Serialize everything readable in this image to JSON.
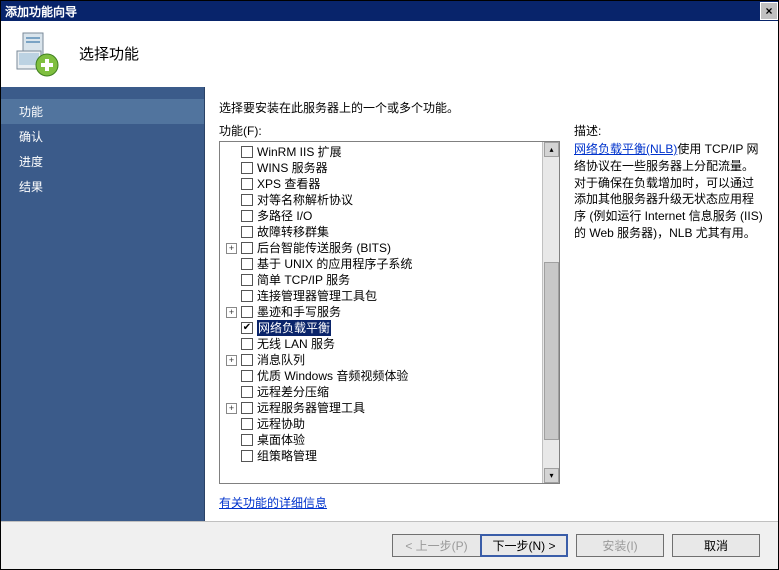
{
  "window": {
    "title": "添加功能向导",
    "close_icon": "×"
  },
  "header": {
    "title": "选择功能"
  },
  "sidebar": {
    "steps": [
      {
        "label": "功能",
        "active": true
      },
      {
        "label": "确认",
        "active": false
      },
      {
        "label": "进度",
        "active": false
      },
      {
        "label": "结果",
        "active": false
      }
    ]
  },
  "main": {
    "instruction": "选择要安装在此服务器上的一个或多个功能。",
    "features_label": "功能(F):",
    "desc_label": "描述:",
    "desc_link_text": "网络负载平衡(NLB)",
    "desc_rest": "使用 TCP/IP 网络协议在一些服务器上分配流量。对于确保在负载增加时，可以通过添加其他服务器升级无状态应用程序 (例如运行 Internet 信息服务 (IIS)的 Web 服务器)，NLB 尤其有用。",
    "more_link": "有关功能的详细信息",
    "tree": [
      {
        "label": "WinRM IIS 扩展",
        "expandable": false,
        "checked": false
      },
      {
        "label": "WINS 服务器",
        "expandable": false,
        "checked": false
      },
      {
        "label": "XPS 查看器",
        "expandable": false,
        "checked": false
      },
      {
        "label": "对等名称解析协议",
        "expandable": false,
        "checked": false
      },
      {
        "label": "多路径 I/O",
        "expandable": false,
        "checked": false
      },
      {
        "label": "故障转移群集",
        "expandable": false,
        "checked": false
      },
      {
        "label": "后台智能传送服务 (BITS)",
        "expandable": true,
        "checked": false
      },
      {
        "label": "基于 UNIX 的应用程序子系统",
        "expandable": false,
        "checked": false
      },
      {
        "label": "简单 TCP/IP 服务",
        "expandable": false,
        "checked": false
      },
      {
        "label": "连接管理器管理工具包",
        "expandable": false,
        "checked": false
      },
      {
        "label": "墨迹和手写服务",
        "expandable": true,
        "checked": false
      },
      {
        "label": "网络负载平衡",
        "expandable": false,
        "checked": true,
        "selected": true
      },
      {
        "label": "无线 LAN 服务",
        "expandable": false,
        "checked": false
      },
      {
        "label": "消息队列",
        "expandable": true,
        "checked": false
      },
      {
        "label": "优质 Windows 音频视频体验",
        "expandable": false,
        "checked": false
      },
      {
        "label": "远程差分压缩",
        "expandable": false,
        "checked": false
      },
      {
        "label": "远程服务器管理工具",
        "expandable": true,
        "checked": false
      },
      {
        "label": "远程协助",
        "expandable": false,
        "checked": false
      },
      {
        "label": "桌面体验",
        "expandable": false,
        "checked": false
      },
      {
        "label": "组策略管理",
        "expandable": false,
        "checked": false
      }
    ]
  },
  "footer": {
    "prev": "< 上一步(P)",
    "next": "下一步(N) >",
    "install": "安装(I)",
    "cancel": "取消"
  }
}
